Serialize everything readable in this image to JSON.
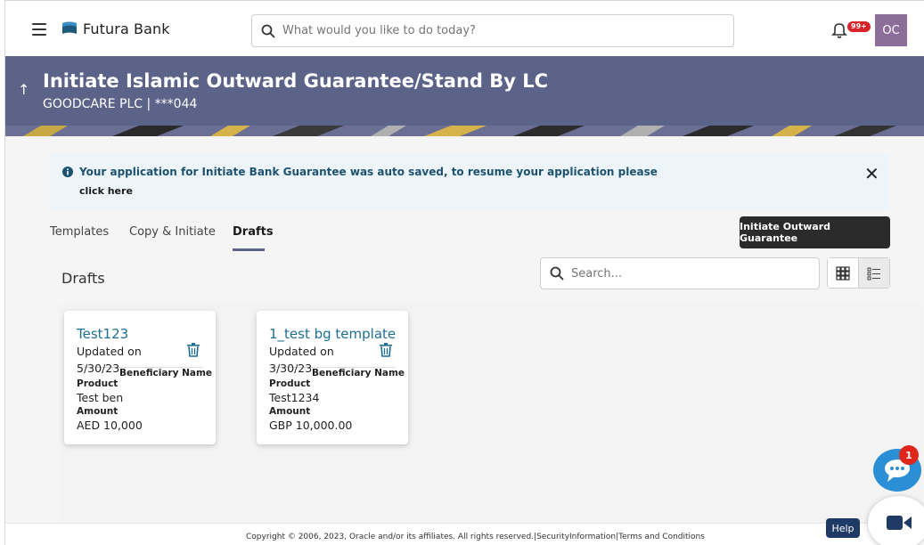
{
  "header": {
    "brand": "Futura Bank",
    "search_placeholder": "What would you like to do today?",
    "notification_badge": "99+",
    "avatar_initials": "OC"
  },
  "banner": {
    "title": "Initiate Islamic Outward Guarantee/Stand By LC",
    "subtitle": "GOODCARE PLC | ***044"
  },
  "alert": {
    "message": "Your application for Initiate Bank Guarantee was auto saved, to resume your application please",
    "link": "click here"
  },
  "tabs": [
    {
      "label": "Templates"
    },
    {
      "label": "Copy & Initiate"
    },
    {
      "label": "Drafts"
    }
  ],
  "initiate_button": "Initiate Outward Guarantee",
  "section_title": "Drafts",
  "search_placeholder": "Search...",
  "drafts": [
    {
      "title": "Test123",
      "updated_label": "Updated on",
      "updated_date": "5/30/23",
      "beneficiary_label": "Beneficiary Name",
      "beneficiary_value": "Test ben",
      "product_label": "Product",
      "amount_label": "Amount",
      "amount_value": "AED 10,000"
    },
    {
      "title": "1_test bg template",
      "updated_label": "Updated on",
      "updated_date": "3/30/23",
      "beneficiary_label": "Beneficiary Name",
      "beneficiary_value": "Test1234",
      "product_label": "Product",
      "amount_label": "Amount",
      "amount_value": "GBP 10,000.00"
    }
  ],
  "footer": {
    "copyright": "Copyright © 2006, 2023, Oracle and/or its affiliates. All rights reserved.|SecurityInformation|Terms and Conditions"
  },
  "help_label": "Help",
  "chat_badge": "1",
  "colors": {
    "banner": "#5c6389",
    "link": "#1f6e94",
    "primary_button": "#2b2b2b",
    "alert_bg": "#eef5fa",
    "chat": "#2b8fd6",
    "badge": "#d8232a"
  }
}
